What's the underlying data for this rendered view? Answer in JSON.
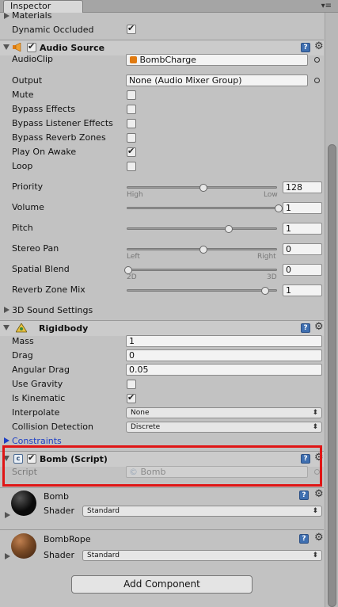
{
  "window": {
    "tab_label": "Inspector",
    "tab_menu": "▾≡"
  },
  "renderer_tail": {
    "materials_label": "Materials",
    "dynamic_occluded_label": "Dynamic Occluded",
    "dynamic_occluded_checked": true
  },
  "audio_source": {
    "title": "Audio Source",
    "enabled": true,
    "audio_clip_label": "AudioClip",
    "audio_clip_value": "BombCharge",
    "output_label": "Output",
    "output_value": "None (Audio Mixer Group)",
    "toggles": [
      {
        "label": "Mute",
        "checked": false
      },
      {
        "label": "Bypass Effects",
        "checked": false
      },
      {
        "label": "Bypass Listener Effects",
        "checked": false
      },
      {
        "label": "Bypass Reverb Zones",
        "checked": false
      },
      {
        "label": "Play On Awake",
        "checked": true
      },
      {
        "label": "Loop",
        "checked": false
      }
    ],
    "priority": {
      "label": "Priority",
      "value": "128",
      "left_caption": "High",
      "right_caption": "Low",
      "fraction": 0.5
    },
    "volume": {
      "label": "Volume",
      "value": "1",
      "fraction": 1.0
    },
    "pitch": {
      "label": "Pitch",
      "value": "1",
      "fraction": 0.67
    },
    "stereo_pan": {
      "label": "Stereo Pan",
      "value": "0",
      "left_caption": "Left",
      "right_caption": "Right",
      "fraction": 0.5
    },
    "spatial_blend": {
      "label": "Spatial Blend",
      "value": "0",
      "left_caption": "2D",
      "right_caption": "3D",
      "fraction": 0.0
    },
    "reverb_zone_mix": {
      "label": "Reverb Zone Mix",
      "value": "1",
      "fraction": 0.91
    },
    "sound_settings_label": "3D Sound Settings"
  },
  "rigidbody": {
    "title": "Rigidbody",
    "mass_label": "Mass",
    "mass_value": "1",
    "drag_label": "Drag",
    "drag_value": "0",
    "angular_drag_label": "Angular Drag",
    "angular_drag_value": "0.05",
    "use_gravity_label": "Use Gravity",
    "use_gravity_checked": false,
    "is_kinematic_label": "Is Kinematic",
    "is_kinematic_checked": true,
    "interpolate_label": "Interpolate",
    "interpolate_value": "None",
    "collision_label": "Collision Detection",
    "collision_value": "Discrete",
    "constraints_label": "Constraints"
  },
  "bomb_script": {
    "title": "Bomb (Script)",
    "enabled": true,
    "script_label": "Script",
    "script_value": "Bomb"
  },
  "materials": [
    {
      "name": "Bomb",
      "shader_label": "Shader",
      "shader_value": "Standard",
      "color": "#0a0a0a"
    },
    {
      "name": "BombRope",
      "shader_label": "Shader",
      "shader_value": "Standard",
      "color": "#7a4a25"
    }
  ],
  "add_component_label": "Add Component",
  "colors": {
    "highlight": "#e01515",
    "help_icon": "#3f6fb0",
    "link": "#1e3fc4"
  }
}
